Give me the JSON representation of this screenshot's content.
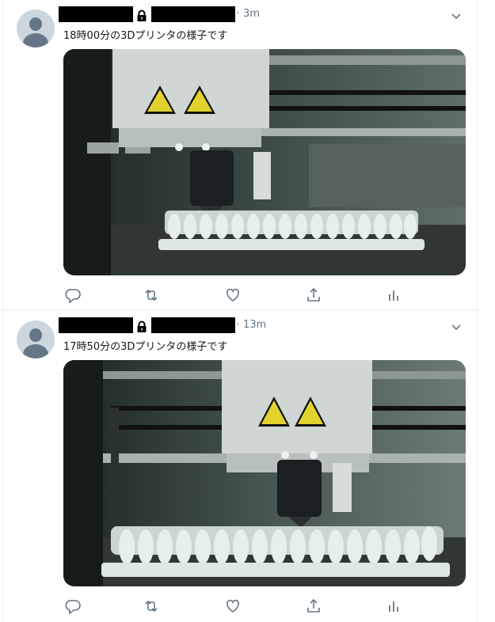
{
  "tweets": [
    {
      "time": "3m",
      "separator": "·",
      "text": "18時00分の3Dプリンタの様子です"
    },
    {
      "time": "13m",
      "separator": "·",
      "text": "17時50分の3Dプリンタの様子です"
    }
  ],
  "colors": {
    "meta": "#657786",
    "icon": "#657786",
    "border": "#e6ecf0",
    "redaction": "#000000"
  },
  "icons": [
    "lock-icon",
    "chevron-down-icon",
    "reply-icon",
    "retweet-icon",
    "like-icon",
    "share-icon",
    "analytics-icon"
  ]
}
